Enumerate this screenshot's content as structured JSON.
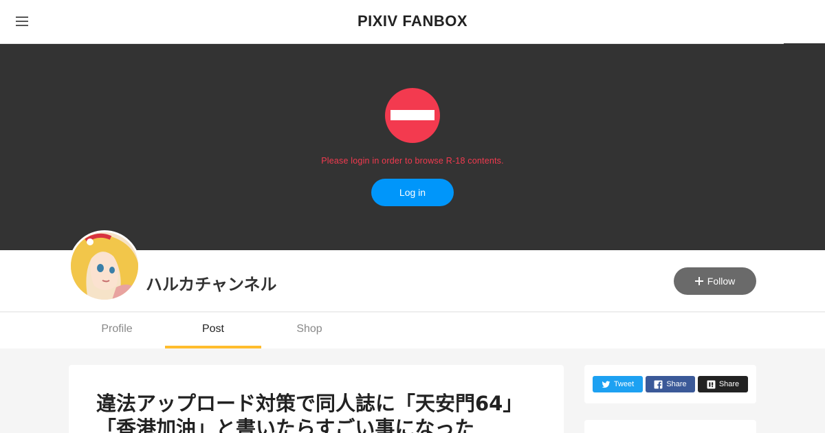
{
  "header": {
    "brand": "PIXIV FANBOX",
    "menu_icon": "hamburger-menu-icon"
  },
  "restriction": {
    "icon": "no-entry-icon",
    "message": "Please login in order to browse R-18 contents.",
    "login_label": "Log in",
    "accent_color": "#f33a4f",
    "login_color": "#0096fa"
  },
  "creator": {
    "name": "ハルカチャンネル",
    "follow_label": "Follow",
    "avatar_icon": "creator-avatar"
  },
  "tabs": [
    {
      "label": "Profile",
      "active": false
    },
    {
      "label": "Post",
      "active": true
    },
    {
      "label": "Shop",
      "active": false
    }
  ],
  "post": {
    "title": "違法アップロード対策で同人誌に「天安門64」「香港加油」と書いたらすごい事になった"
  },
  "share": {
    "tweet_label": "Tweet",
    "facebook_label": "Share",
    "hatena_label": "Share"
  },
  "colors": {
    "tab_active_underline": "#ffbd2d",
    "cover_background": "#333333"
  }
}
